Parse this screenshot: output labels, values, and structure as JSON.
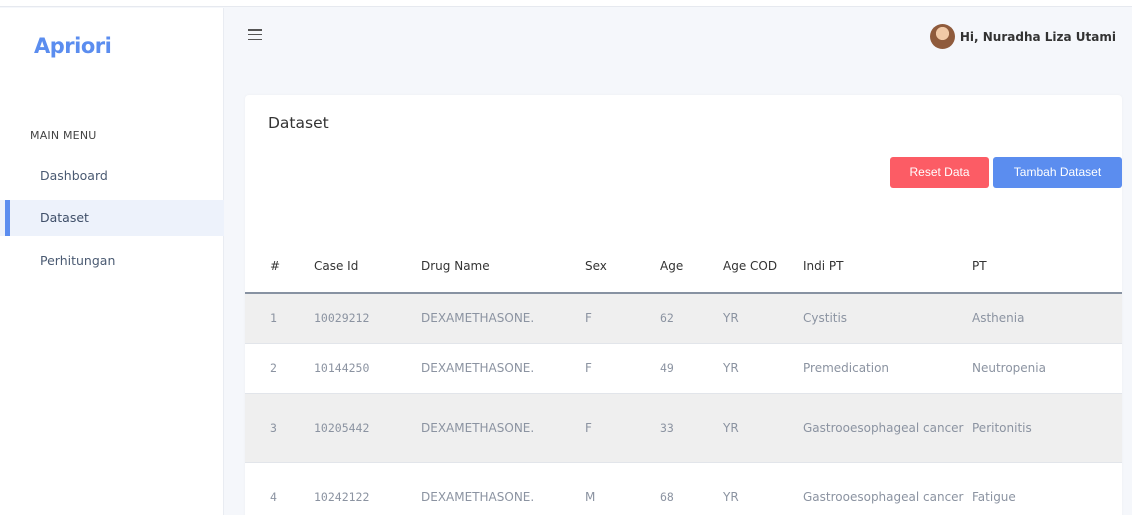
{
  "app": {
    "brand": "Apriori"
  },
  "sidebar": {
    "heading": "MAIN MENU",
    "items": [
      {
        "label": "Dashboard"
      },
      {
        "label": "Dataset"
      },
      {
        "label": "Perhitungan"
      }
    ]
  },
  "header": {
    "user_greeting": "Hi, Nuradha Liza Utami"
  },
  "page": {
    "title": "Dataset",
    "reset_label": "Reset Data",
    "add_label": "Tambah Dataset"
  },
  "table": {
    "headers": [
      "#",
      "Case Id",
      "Drug Name",
      "Sex",
      "Age",
      "Age COD",
      "Indi PT",
      "PT"
    ],
    "rows": [
      [
        "1",
        "10029212",
        "DEXAMETHASONE.",
        "F",
        "62",
        "YR",
        "Cystitis",
        "Asthenia"
      ],
      [
        "2",
        "10144250",
        "DEXAMETHASONE.",
        "F",
        "49",
        "YR",
        "Premedication",
        "Neutropenia"
      ],
      [
        "3",
        "10205442",
        "DEXAMETHASONE.",
        "F",
        "33",
        "YR",
        "Gastrooesophageal cancer",
        "Peritonitis"
      ],
      [
        "4",
        "10242122",
        "DEXAMETHASONE.",
        "M",
        "68",
        "YR",
        "Gastrooesophageal cancer",
        "Fatigue"
      ]
    ]
  },
  "colors": {
    "accent": "#5b8def",
    "danger": "#fc5c65"
  }
}
